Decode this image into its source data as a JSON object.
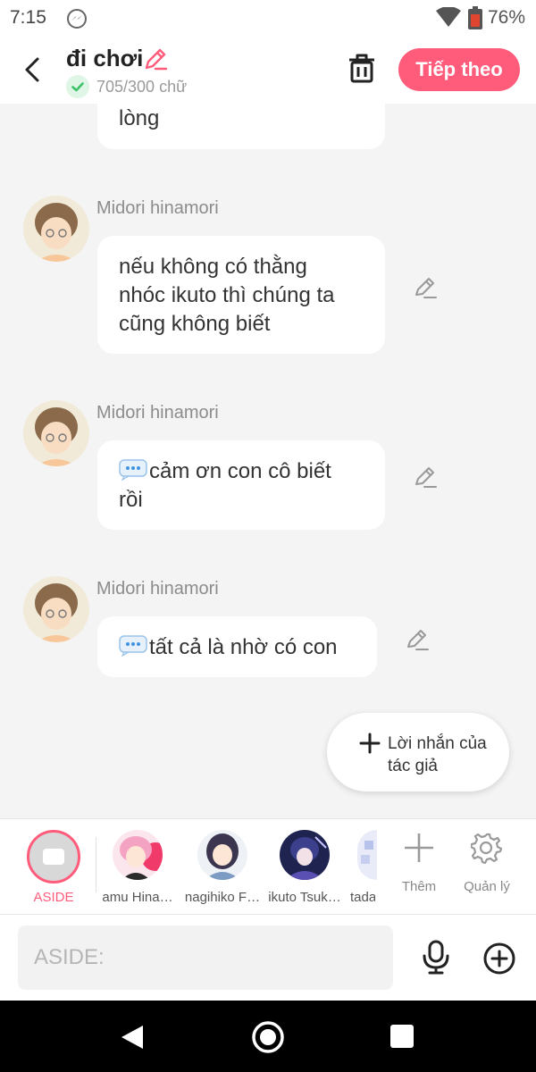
{
  "status_bar": {
    "time": "7:15",
    "battery": "76%"
  },
  "header": {
    "title": "đi chơi",
    "word_count": "705/300 chữ",
    "next_label": "Tiếp theo"
  },
  "chat": {
    "partial_text": "lòng",
    "messages": [
      {
        "sender": "Midori hinamori",
        "lines": [
          "nếu không có thằng",
          "nhóc ikuto thì chúng ta",
          "cũng không biết"
        ]
      },
      {
        "sender": "Midori hinamori",
        "lines": [
          "cảm ơn con cô biết",
          "rồi"
        ]
      },
      {
        "sender": "Midori hinamori",
        "lines": [
          "tất cả là nhờ có con"
        ]
      }
    ],
    "author_note": "Lời nhắn của tác giả"
  },
  "characters": {
    "aside_label": "ASIDE",
    "list": [
      {
        "name": "amu Hina…"
      },
      {
        "name": "nagihiko F…"
      },
      {
        "name": "ikuto Tsuk…"
      },
      {
        "name": "tada"
      }
    ],
    "add_label": "Thêm",
    "manage_label": "Quản lý"
  },
  "composer": {
    "placeholder": "ASIDE:"
  },
  "colors": {
    "accent": "#ff5c7c",
    "check": "#3cc36a",
    "background": "#f4f4f4"
  }
}
